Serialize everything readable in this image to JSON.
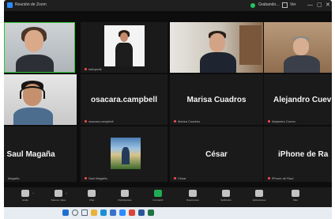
{
  "titlebar": {
    "title": "Reunión de Zoom",
    "status": "Grabando…",
    "view": "Ver",
    "min": "—",
    "max": "▢",
    "close": "✕"
  },
  "tiles": [
    {
      "id": "t1",
      "display": "video",
      "name": "",
      "caption": ""
    },
    {
      "id": "t2",
      "display": "video",
      "name": "",
      "caption": "intérprete"
    },
    {
      "id": "t3",
      "display": "video",
      "name": "",
      "caption": ""
    },
    {
      "id": "t4",
      "display": "video",
      "name": "",
      "caption": ""
    },
    {
      "id": "t5",
      "display": "video",
      "name": "",
      "caption": ""
    },
    {
      "id": "t6",
      "display": "name",
      "name": "osacara.campbell",
      "caption": "osacara.campbell"
    },
    {
      "id": "t7",
      "display": "name",
      "name": "Marisa Cuadros",
      "caption": "Marisa Cuadros"
    },
    {
      "id": "t8",
      "display": "name",
      "name": "Alejandro Cuev",
      "caption": "Alejandro Cueva"
    },
    {
      "id": "t9",
      "display": "name",
      "name": ". Saul Magaña",
      "caption": "Magaña"
    },
    {
      "id": "t10",
      "display": "video",
      "name": "",
      "caption": "Saul Magaña"
    },
    {
      "id": "t11",
      "display": "name",
      "name": "César",
      "caption": "César"
    },
    {
      "id": "t12",
      "display": "name",
      "name": "iPhone de Ra",
      "caption": "iPhone de Raul"
    }
  ],
  "toolbar": {
    "items": [
      {
        "label": "Audio",
        "icon": "microphone-icon",
        "color": "#e0e0e0"
      },
      {
        "label": "Detener video",
        "icon": "video-camera-icon",
        "color": "#e0e0e0"
      },
      {
        "label": "Chat",
        "icon": "chat-icon",
        "color": "#e0e0e0"
      },
      {
        "label": "Participantes",
        "icon": "people-icon",
        "color": "#e0e0e0"
      },
      {
        "label": "Compartir",
        "icon": "share-icon",
        "color": "#22c55e"
      },
      {
        "label": "Reacciones",
        "icon": "reactions-icon",
        "color": "#e0e0e0"
      },
      {
        "label": "Subtítulos",
        "icon": "captions-icon",
        "color": "#e0e0e0"
      },
      {
        "label": "Aplicaciones",
        "icon": "apps-icon",
        "color": "#e0e0e0"
      },
      {
        "label": "Más",
        "icon": "more-icon",
        "color": "#e0e0e0"
      }
    ]
  },
  "taskbar": {
    "apps": [
      {
        "icon": "windows-start-icon",
        "color": "#1f6fd1"
      },
      {
        "icon": "search-icon",
        "color": "#5b6675"
      },
      {
        "icon": "task-view-icon",
        "color": "#5b6675"
      },
      {
        "icon": "file-explorer-icon",
        "color": "#e8b33b"
      },
      {
        "icon": "edge-browser-icon",
        "color": "#1b8fd6"
      },
      {
        "icon": "store-icon",
        "color": "#3a71c9"
      },
      {
        "icon": "zoom-icon",
        "color": "#2d8cff"
      },
      {
        "icon": "chrome-icon",
        "color": "#db4437"
      },
      {
        "icon": "word-icon",
        "color": "#2b579a"
      },
      {
        "icon": "excel-icon",
        "color": "#217346"
      }
    ],
    "time": "",
    "date": ""
  },
  "colors": {
    "active_speaker": "#36c23a",
    "stage_bg": "#0d0d0d",
    "tile_bg": "#1a1a1a",
    "toolbar_bg": "#1b1b1b",
    "taskbar_bg": "#e7ecf2"
  }
}
